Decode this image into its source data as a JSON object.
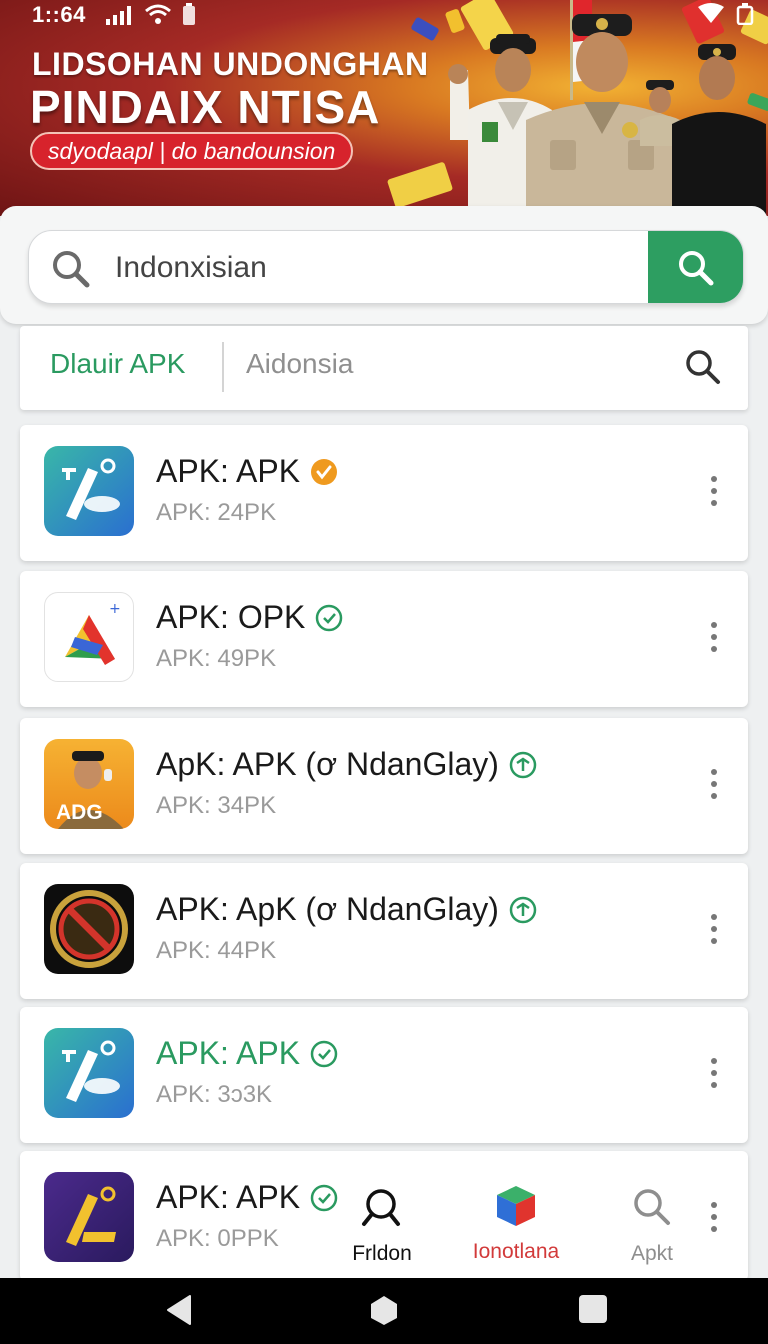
{
  "status_bar": {
    "time": "1::64"
  },
  "banner": {
    "title_line1": "LIDSOHAN UNDONGHAN",
    "title_line2": "PINDAIX NTISA",
    "subtitle": "sdyodaapl | do bandounsion"
  },
  "search": {
    "value": "Indonxisian"
  },
  "filter": {
    "label": "Dlauir APK",
    "input_value": "Aidonsia"
  },
  "apps": [
    {
      "name": "APK: APK",
      "size": "APK: 24PK",
      "badge": "verified-check-icon"
    },
    {
      "name": "APK: OPK",
      "size": "APK: 49PK",
      "badge": "check-circle-icon"
    },
    {
      "name": "ApK: APK (ơ NdanGlay)",
      "size": "APK: 34PK",
      "badge": "plus-circle-icon",
      "icon_text": "ADG"
    },
    {
      "name": "APK: ApK (ơ NdanGlay)",
      "size": "APK: 44PK",
      "badge": "plus-circle-icon"
    },
    {
      "name": "APK: APK",
      "size": "APK: 3ɔ3K",
      "badge": "check-circle-icon"
    },
    {
      "name": "APK: APK",
      "size": "APK: 0PPK",
      "badge": "check-circle-icon"
    }
  ],
  "bottom_nav": [
    {
      "label": "Frldon",
      "icon": "search-icon"
    },
    {
      "label": "Ionotlana",
      "icon": "cube-icon"
    },
    {
      "label": "Apkt",
      "icon": "search-icon"
    }
  ],
  "colors": {
    "accent_green": "#2d9e61",
    "banner_red": "#a52a25",
    "nav_active_red": "#d23a3a"
  }
}
